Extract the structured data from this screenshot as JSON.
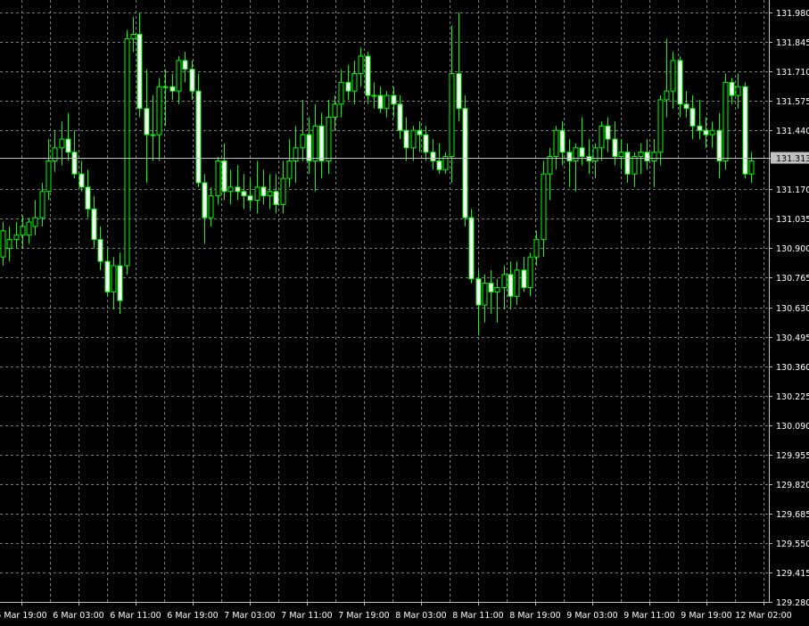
{
  "chart_data": {
    "type": "candlestick",
    "title": "",
    "xlabel": "",
    "ylabel": "",
    "ylim": [
      129.28,
      131.98
    ],
    "grid": true,
    "y_ticks": [
      "131.980",
      "131.845",
      "131.710",
      "131.575",
      "131.440",
      "131.313",
      "131.170",
      "131.035",
      "130.900",
      "130.765",
      "130.630",
      "130.495",
      "130.360",
      "130.225",
      "130.090",
      "129.955",
      "129.820",
      "129.685",
      "129.550",
      "129.415",
      "129.280"
    ],
    "x_ticks": [
      "5 Mar 19:00",
      "6 Mar 03:00",
      "6 Mar 11:00",
      "6 Mar 19:00",
      "7 Mar 03:00",
      "7 Mar 11:00",
      "7 Mar 19:00",
      "8 Mar 03:00",
      "8 Mar 11:00",
      "8 Mar 19:00",
      "9 Mar 03:00",
      "9 Mar 11:00",
      "9 Mar 19:00",
      "12 Mar 02:00"
    ],
    "current_price": "131.313",
    "colors": {
      "background": "#000000",
      "grid": "#7a7a7a",
      "axis": "#c0c0c0",
      "bull_body": "#000000",
      "bear_body": "#ffffff",
      "wick": "#00ff00",
      "body_outline": "#00ff00",
      "price_tag": "#c0c0c0"
    },
    "candles": [
      {
        "o": 130.86,
        "h": 131.02,
        "l": 130.82,
        "c": 130.98
      },
      {
        "o": 130.9,
        "h": 131.0,
        "l": 130.84,
        "c": 130.94
      },
      {
        "o": 130.94,
        "h": 131.02,
        "l": 130.9,
        "c": 130.96
      },
      {
        "o": 130.96,
        "h": 131.05,
        "l": 130.9,
        "c": 131.0
      },
      {
        "o": 130.96,
        "h": 131.04,
        "l": 130.92,
        "c": 131.02
      },
      {
        "o": 131.0,
        "h": 131.12,
        "l": 130.96,
        "c": 131.04
      },
      {
        "o": 131.04,
        "h": 131.2,
        "l": 131.0,
        "c": 131.16
      },
      {
        "o": 131.16,
        "h": 131.4,
        "l": 131.12,
        "c": 131.3
      },
      {
        "o": 131.3,
        "h": 131.44,
        "l": 131.25,
        "c": 131.36
      },
      {
        "o": 131.36,
        "h": 131.48,
        "l": 131.28,
        "c": 131.4
      },
      {
        "o": 131.4,
        "h": 131.52,
        "l": 131.3,
        "c": 131.34
      },
      {
        "o": 131.34,
        "h": 131.44,
        "l": 131.22,
        "c": 131.24
      },
      {
        "o": 131.24,
        "h": 131.3,
        "l": 131.16,
        "c": 131.18
      },
      {
        "o": 131.18,
        "h": 131.26,
        "l": 131.04,
        "c": 131.08
      },
      {
        "o": 131.08,
        "h": 131.14,
        "l": 130.9,
        "c": 130.94
      },
      {
        "o": 130.94,
        "h": 131.0,
        "l": 130.8,
        "c": 130.84
      },
      {
        "o": 130.84,
        "h": 130.9,
        "l": 130.68,
        "c": 130.7
      },
      {
        "o": 130.7,
        "h": 130.86,
        "l": 130.62,
        "c": 130.82
      },
      {
        "o": 130.82,
        "h": 130.88,
        "l": 130.6,
        "c": 130.66
      },
      {
        "o": 130.82,
        "h": 131.9,
        "l": 130.78,
        "c": 131.86
      },
      {
        "o": 131.86,
        "h": 131.96,
        "l": 131.8,
        "c": 131.88
      },
      {
        "o": 131.88,
        "h": 131.98,
        "l": 131.5,
        "c": 131.54
      },
      {
        "o": 131.54,
        "h": 131.72,
        "l": 131.2,
        "c": 131.42
      },
      {
        "o": 131.42,
        "h": 131.6,
        "l": 131.3,
        "c": 131.42
      },
      {
        "o": 131.42,
        "h": 131.68,
        "l": 131.3,
        "c": 131.64
      },
      {
        "o": 131.64,
        "h": 131.72,
        "l": 131.46,
        "c": 131.64
      },
      {
        "o": 131.64,
        "h": 131.7,
        "l": 131.58,
        "c": 131.62
      },
      {
        "o": 131.62,
        "h": 131.78,
        "l": 131.56,
        "c": 131.76
      },
      {
        "o": 131.76,
        "h": 131.8,
        "l": 131.66,
        "c": 131.72
      },
      {
        "o": 131.72,
        "h": 131.76,
        "l": 131.58,
        "c": 131.62
      },
      {
        "o": 131.62,
        "h": 131.7,
        "l": 131.18,
        "c": 131.2
      },
      {
        "o": 131.2,
        "h": 131.24,
        "l": 130.92,
        "c": 131.04
      },
      {
        "o": 131.04,
        "h": 131.18,
        "l": 131.0,
        "c": 131.14
      },
      {
        "o": 131.14,
        "h": 131.32,
        "l": 131.1,
        "c": 131.3
      },
      {
        "o": 131.3,
        "h": 131.38,
        "l": 131.12,
        "c": 131.16
      },
      {
        "o": 131.16,
        "h": 131.26,
        "l": 131.1,
        "c": 131.18
      },
      {
        "o": 131.18,
        "h": 131.28,
        "l": 131.12,
        "c": 131.16
      },
      {
        "o": 131.16,
        "h": 131.24,
        "l": 131.08,
        "c": 131.14
      },
      {
        "o": 131.14,
        "h": 131.22,
        "l": 131.08,
        "c": 131.12
      },
      {
        "o": 131.12,
        "h": 131.3,
        "l": 131.06,
        "c": 131.18
      },
      {
        "o": 131.18,
        "h": 131.26,
        "l": 131.1,
        "c": 131.14
      },
      {
        "o": 131.14,
        "h": 131.24,
        "l": 131.08,
        "c": 131.16
      },
      {
        "o": 131.16,
        "h": 131.24,
        "l": 131.06,
        "c": 131.1
      },
      {
        "o": 131.1,
        "h": 131.3,
        "l": 131.06,
        "c": 131.22
      },
      {
        "o": 131.22,
        "h": 131.4,
        "l": 131.18,
        "c": 131.3
      },
      {
        "o": 131.3,
        "h": 131.46,
        "l": 131.2,
        "c": 131.36
      },
      {
        "o": 131.36,
        "h": 131.58,
        "l": 131.3,
        "c": 131.42
      },
      {
        "o": 131.42,
        "h": 131.5,
        "l": 131.24,
        "c": 131.3
      },
      {
        "o": 131.3,
        "h": 131.56,
        "l": 131.16,
        "c": 131.46
      },
      {
        "o": 131.46,
        "h": 131.52,
        "l": 131.22,
        "c": 131.3
      },
      {
        "o": 131.3,
        "h": 131.58,
        "l": 131.24,
        "c": 131.5
      },
      {
        "o": 131.5,
        "h": 131.6,
        "l": 131.44,
        "c": 131.56
      },
      {
        "o": 131.56,
        "h": 131.72,
        "l": 131.5,
        "c": 131.66
      },
      {
        "o": 131.66,
        "h": 131.74,
        "l": 131.58,
        "c": 131.62
      },
      {
        "o": 131.62,
        "h": 131.76,
        "l": 131.56,
        "c": 131.7
      },
      {
        "o": 131.7,
        "h": 131.82,
        "l": 131.64,
        "c": 131.78
      },
      {
        "o": 131.78,
        "h": 131.8,
        "l": 131.56,
        "c": 131.6
      },
      {
        "o": 131.6,
        "h": 131.66,
        "l": 131.54,
        "c": 131.6
      },
      {
        "o": 131.6,
        "h": 131.64,
        "l": 131.52,
        "c": 131.54
      },
      {
        "o": 131.54,
        "h": 131.62,
        "l": 131.5,
        "c": 131.6
      },
      {
        "o": 131.6,
        "h": 131.64,
        "l": 131.5,
        "c": 131.56
      },
      {
        "o": 131.56,
        "h": 131.6,
        "l": 131.4,
        "c": 131.44
      },
      {
        "o": 131.44,
        "h": 131.5,
        "l": 131.3,
        "c": 131.36
      },
      {
        "o": 131.36,
        "h": 131.46,
        "l": 131.3,
        "c": 131.44
      },
      {
        "o": 131.44,
        "h": 131.48,
        "l": 131.34,
        "c": 131.42
      },
      {
        "o": 131.42,
        "h": 131.46,
        "l": 131.3,
        "c": 131.34
      },
      {
        "o": 131.34,
        "h": 131.4,
        "l": 131.26,
        "c": 131.3
      },
      {
        "o": 131.3,
        "h": 131.38,
        "l": 131.24,
        "c": 131.26
      },
      {
        "o": 131.26,
        "h": 131.34,
        "l": 131.24,
        "c": 131.32
      },
      {
        "o": 131.32,
        "h": 131.92,
        "l": 131.2,
        "c": 131.7
      },
      {
        "o": 131.7,
        "h": 131.98,
        "l": 131.48,
        "c": 131.54
      },
      {
        "o": 131.54,
        "h": 131.6,
        "l": 131.0,
        "c": 131.04
      },
      {
        "o": 131.04,
        "h": 131.08,
        "l": 130.74,
        "c": 130.76
      },
      {
        "o": 130.76,
        "h": 130.8,
        "l": 130.5,
        "c": 130.64
      },
      {
        "o": 130.64,
        "h": 130.78,
        "l": 130.56,
        "c": 130.74
      },
      {
        "o": 130.74,
        "h": 130.8,
        "l": 130.6,
        "c": 130.7
      },
      {
        "o": 130.7,
        "h": 130.76,
        "l": 130.56,
        "c": 130.72
      },
      {
        "o": 130.72,
        "h": 130.82,
        "l": 130.62,
        "c": 130.78
      },
      {
        "o": 130.78,
        "h": 130.84,
        "l": 130.62,
        "c": 130.68
      },
      {
        "o": 130.68,
        "h": 130.84,
        "l": 130.64,
        "c": 130.8
      },
      {
        "o": 130.8,
        "h": 130.86,
        "l": 130.7,
        "c": 130.72
      },
      {
        "o": 130.72,
        "h": 130.88,
        "l": 130.68,
        "c": 130.86
      },
      {
        "o": 130.86,
        "h": 130.98,
        "l": 130.82,
        "c": 130.94
      },
      {
        "o": 130.94,
        "h": 131.3,
        "l": 130.86,
        "c": 131.24
      },
      {
        "o": 131.24,
        "h": 131.36,
        "l": 131.12,
        "c": 131.32
      },
      {
        "o": 131.32,
        "h": 131.46,
        "l": 131.26,
        "c": 131.44
      },
      {
        "o": 131.44,
        "h": 131.48,
        "l": 131.28,
        "c": 131.34
      },
      {
        "o": 131.34,
        "h": 131.4,
        "l": 131.18,
        "c": 131.3
      },
      {
        "o": 131.3,
        "h": 131.38,
        "l": 131.16,
        "c": 131.36
      },
      {
        "o": 131.36,
        "h": 131.5,
        "l": 131.28,
        "c": 131.32
      },
      {
        "o": 131.32,
        "h": 131.4,
        "l": 131.24,
        "c": 131.3
      },
      {
        "o": 131.3,
        "h": 131.38,
        "l": 131.22,
        "c": 131.36
      },
      {
        "o": 131.36,
        "h": 131.48,
        "l": 131.3,
        "c": 131.46
      },
      {
        "o": 131.46,
        "h": 131.5,
        "l": 131.34,
        "c": 131.4
      },
      {
        "o": 131.4,
        "h": 131.48,
        "l": 131.28,
        "c": 131.32
      },
      {
        "o": 131.32,
        "h": 131.4,
        "l": 131.26,
        "c": 131.34
      },
      {
        "o": 131.34,
        "h": 131.38,
        "l": 131.2,
        "c": 131.24
      },
      {
        "o": 131.24,
        "h": 131.34,
        "l": 131.18,
        "c": 131.32
      },
      {
        "o": 131.32,
        "h": 131.38,
        "l": 131.24,
        "c": 131.34
      },
      {
        "o": 131.34,
        "h": 131.4,
        "l": 131.26,
        "c": 131.3
      },
      {
        "o": 131.3,
        "h": 131.4,
        "l": 131.18,
        "c": 131.34
      },
      {
        "o": 131.34,
        "h": 131.6,
        "l": 131.28,
        "c": 131.58
      },
      {
        "o": 131.58,
        "h": 131.86,
        "l": 131.5,
        "c": 131.62
      },
      {
        "o": 131.62,
        "h": 131.8,
        "l": 131.54,
        "c": 131.76
      },
      {
        "o": 131.76,
        "h": 131.78,
        "l": 131.5,
        "c": 131.56
      },
      {
        "o": 131.56,
        "h": 131.62,
        "l": 131.5,
        "c": 131.54
      },
      {
        "o": 131.54,
        "h": 131.6,
        "l": 131.4,
        "c": 131.46
      },
      {
        "o": 131.46,
        "h": 131.58,
        "l": 131.4,
        "c": 131.44
      },
      {
        "o": 131.44,
        "h": 131.5,
        "l": 131.36,
        "c": 131.42
      },
      {
        "o": 131.42,
        "h": 131.48,
        "l": 131.36,
        "c": 131.44
      },
      {
        "o": 131.44,
        "h": 131.52,
        "l": 131.22,
        "c": 131.3
      },
      {
        "o": 131.3,
        "h": 131.7,
        "l": 131.26,
        "c": 131.66
      },
      {
        "o": 131.66,
        "h": 131.68,
        "l": 131.56,
        "c": 131.6
      },
      {
        "o": 131.6,
        "h": 131.7,
        "l": 131.54,
        "c": 131.64
      },
      {
        "o": 131.64,
        "h": 131.66,
        "l": 131.22,
        "c": 131.24
      },
      {
        "o": 131.24,
        "h": 131.34,
        "l": 131.2,
        "c": 131.3
      }
    ]
  }
}
